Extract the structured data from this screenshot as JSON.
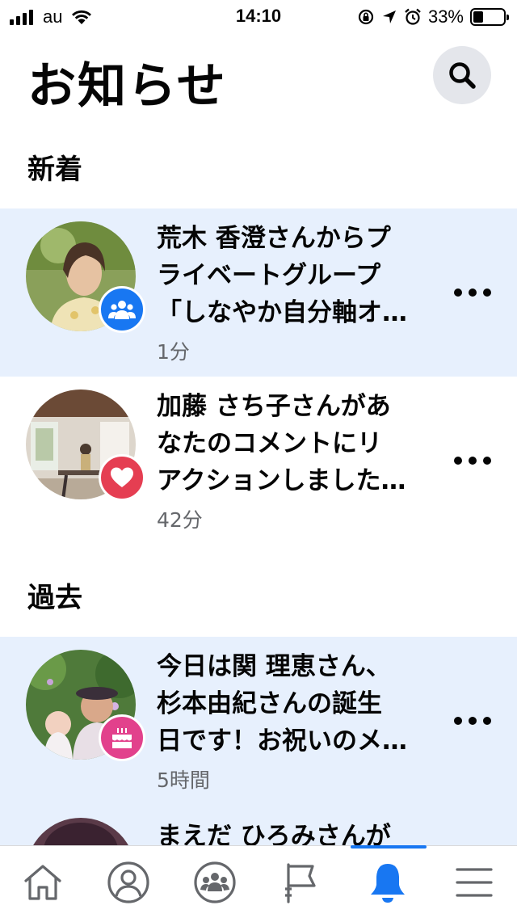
{
  "status_bar": {
    "carrier": "au",
    "time": "14:10",
    "battery_percent": "33%",
    "battery_level": 0.33
  },
  "header": {
    "title": "お知らせ",
    "search_icon": "search-icon"
  },
  "sections": {
    "new_label": "新着",
    "past_label": "過去"
  },
  "notifications": [
    {
      "lines": [
        "荒木 香澄さんからプ",
        "ライベートグループ",
        "「しなやか自分軸オ…"
      ],
      "time": "1分",
      "badge_icon": "group-icon",
      "badge_color": "#1877f2",
      "unread": true
    },
    {
      "lines": [
        "加藤 さち子さんがあ",
        "なたのコメントにリ",
        "アクションしました…"
      ],
      "time": "42分",
      "badge_icon": "heart-icon",
      "badge_color": "#e53e52",
      "unread": false
    },
    {
      "lines": [
        "今日は関 理恵さん、",
        "杉本由紀さんの誕生",
        "日です！お祝いのメ…"
      ],
      "time": "5時間",
      "badge_icon": "cake-icon",
      "badge_color": "#e2418c",
      "unread": true
    },
    {
      "lines": [
        "まえだ ひろみさんが"
      ],
      "unread": true
    }
  ],
  "bottom_nav": {
    "items": [
      "home-icon",
      "profile-icon",
      "groups-icon",
      "pages-flag-icon",
      "notifications-bell-icon",
      "menu-icon"
    ],
    "active": "notifications-bell-icon",
    "active_color": "#1877f2"
  }
}
